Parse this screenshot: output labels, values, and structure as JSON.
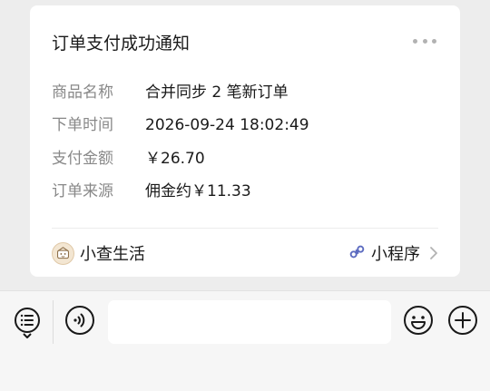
{
  "card": {
    "title": "订单支付成功通知",
    "fields": [
      {
        "label": "商品名称",
        "value": "合并同步 2 笔新订单"
      },
      {
        "label": "下单时间",
        "value": "2026-09-24 18:02:49"
      },
      {
        "label": "支付金额",
        "value": "￥26.70"
      },
      {
        "label": "订单来源",
        "value": "佣金约￥11.33"
      }
    ],
    "footer": {
      "app_name": "小查生活",
      "miniprogram_label": "小程序"
    }
  },
  "input_bar": {
    "icons": [
      "list-menu-icon",
      "voice-icon",
      "emoji-icon",
      "plus-icon"
    ]
  }
}
